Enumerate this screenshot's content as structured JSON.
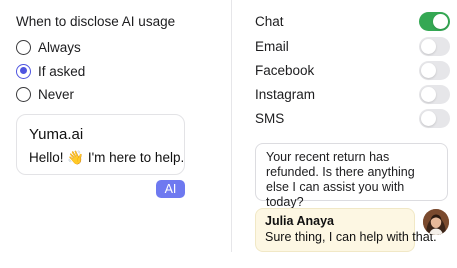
{
  "ai_disclosure": {
    "title": "When to disclose AI usage",
    "options": [
      {
        "label": "Always",
        "selected": false
      },
      {
        "label": "If asked",
        "selected": true
      },
      {
        "label": "Never",
        "selected": false
      }
    ]
  },
  "preview": {
    "brand": "Yuma.ai",
    "message": "Hello! 👋 I'm here to help.",
    "badge": "AI"
  },
  "channels": [
    {
      "label": "Chat",
      "enabled": true
    },
    {
      "label": "Email",
      "enabled": false
    },
    {
      "label": "Facebook",
      "enabled": false
    },
    {
      "label": "Instagram",
      "enabled": false
    },
    {
      "label": "SMS",
      "enabled": false
    }
  ],
  "conversation": {
    "bot_message": "Your recent return has refunded. Is there anything else I can assist you with today?",
    "agent_name": "Julia Anaya",
    "agent_message": "Sure thing, I can help with that."
  },
  "colors": {
    "accent": "#4f55e0",
    "badge": "#6e79f0",
    "toggle_on": "#34a853",
    "toggle_off": "#e6e6e9",
    "agent_bubble": "#fdf7e3"
  }
}
